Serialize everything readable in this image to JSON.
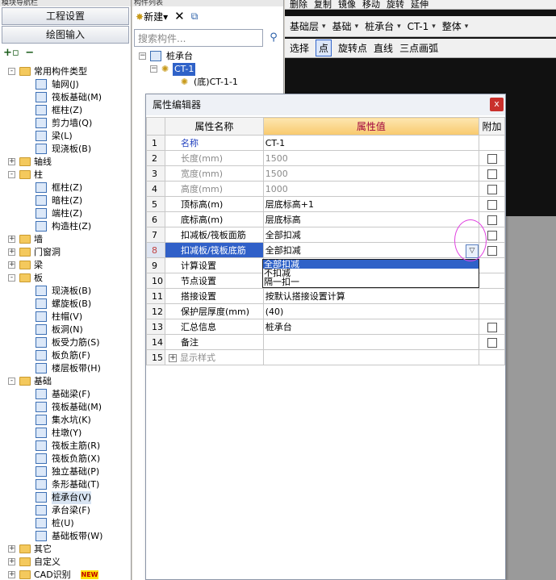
{
  "left_panel": {
    "title": "模块导航栏",
    "btn_settings": "工程设置",
    "btn_drawing": "绘图输入",
    "tree": [
      {
        "label": "常用构件类型",
        "level": 0,
        "kind": "folder",
        "exp": "-"
      },
      {
        "label": "轴网(J)",
        "level": 1,
        "kind": "item"
      },
      {
        "label": "筏板基础(M)",
        "level": 1,
        "kind": "item"
      },
      {
        "label": "框柱(Z)",
        "level": 1,
        "kind": "item"
      },
      {
        "label": "剪力墙(Q)",
        "level": 1,
        "kind": "item"
      },
      {
        "label": "梁(L)",
        "level": 1,
        "kind": "item"
      },
      {
        "label": "现浇板(B)",
        "level": 1,
        "kind": "item"
      },
      {
        "label": "轴线",
        "level": 0,
        "kind": "folder",
        "exp": "+"
      },
      {
        "label": "柱",
        "level": 0,
        "kind": "folder",
        "exp": "-"
      },
      {
        "label": "框柱(Z)",
        "level": 1,
        "kind": "item"
      },
      {
        "label": "暗柱(Z)",
        "level": 1,
        "kind": "item"
      },
      {
        "label": "端柱(Z)",
        "level": 1,
        "kind": "item"
      },
      {
        "label": "构造柱(Z)",
        "level": 1,
        "kind": "item"
      },
      {
        "label": "墙",
        "level": 0,
        "kind": "folder",
        "exp": "+"
      },
      {
        "label": "门窗洞",
        "level": 0,
        "kind": "folder",
        "exp": "+"
      },
      {
        "label": "梁",
        "level": 0,
        "kind": "folder",
        "exp": "+"
      },
      {
        "label": "板",
        "level": 0,
        "kind": "folder",
        "exp": "-"
      },
      {
        "label": "现浇板(B)",
        "level": 1,
        "kind": "item"
      },
      {
        "label": "螺旋板(B)",
        "level": 1,
        "kind": "item"
      },
      {
        "label": "柱帽(V)",
        "level": 1,
        "kind": "item"
      },
      {
        "label": "板洞(N)",
        "level": 1,
        "kind": "item"
      },
      {
        "label": "板受力筋(S)",
        "level": 1,
        "kind": "item"
      },
      {
        "label": "板负筋(F)",
        "level": 1,
        "kind": "item"
      },
      {
        "label": "楼层板带(H)",
        "level": 1,
        "kind": "item"
      },
      {
        "label": "基础",
        "level": 0,
        "kind": "folder",
        "exp": "-"
      },
      {
        "label": "基础梁(F)",
        "level": 1,
        "kind": "item"
      },
      {
        "label": "筏板基础(M)",
        "level": 1,
        "kind": "item"
      },
      {
        "label": "集水坑(K)",
        "level": 1,
        "kind": "item"
      },
      {
        "label": "柱墩(Y)",
        "level": 1,
        "kind": "item"
      },
      {
        "label": "筏板主筋(R)",
        "level": 1,
        "kind": "item"
      },
      {
        "label": "筏板负筋(X)",
        "level": 1,
        "kind": "item"
      },
      {
        "label": "独立基础(P)",
        "level": 1,
        "kind": "item"
      },
      {
        "label": "条形基础(T)",
        "level": 1,
        "kind": "item"
      },
      {
        "label": "桩承台(V)",
        "level": 1,
        "kind": "item",
        "selected": true
      },
      {
        "label": "承台梁(F)",
        "level": 1,
        "kind": "item"
      },
      {
        "label": "桩(U)",
        "level": 1,
        "kind": "item"
      },
      {
        "label": "基础板带(W)",
        "level": 1,
        "kind": "item"
      },
      {
        "label": "其它",
        "level": 0,
        "kind": "folder",
        "exp": "+"
      },
      {
        "label": "自定义",
        "level": 0,
        "kind": "folder",
        "exp": "+"
      },
      {
        "label": "CAD识别",
        "level": 0,
        "kind": "folder",
        "exp": "+",
        "badge": "NEW"
      }
    ]
  },
  "mid_panel": {
    "title": "构件列表",
    "new_label": "新建",
    "search_placeholder": "搜索构件...",
    "tree": {
      "root": "桩承台",
      "child": "CT-1",
      "grandchild": "(底)CT-1-1"
    }
  },
  "toolbar": {
    "row1": [
      "删除",
      "复制",
      "镜像",
      "移动",
      "旋转",
      "延伸"
    ],
    "row2": [
      "基础层",
      "基础",
      "桩承台",
      "CT-1",
      "整体"
    ],
    "row3": [
      "选择",
      "点",
      "旋转点",
      "直线",
      "三点画弧"
    ]
  },
  "dialog": {
    "title": "属性编辑器",
    "col_name": "属性名称",
    "col_value": "属性值",
    "col_add": "附加",
    "rows": [
      {
        "num": "1",
        "name": "名称",
        "value": "CT-1",
        "checkbox": false,
        "style": "blue"
      },
      {
        "num": "2",
        "name": "长度(mm)",
        "value": "1500",
        "checkbox": true,
        "style": "disabled"
      },
      {
        "num": "3",
        "name": "宽度(mm)",
        "value": "1500",
        "checkbox": true,
        "style": "disabled"
      },
      {
        "num": "4",
        "name": "高度(mm)",
        "value": "1000",
        "checkbox": true,
        "style": "disabled"
      },
      {
        "num": "5",
        "name": "顶标高(m)",
        "value": "层底标高+1",
        "checkbox": true,
        "style": ""
      },
      {
        "num": "6",
        "name": "底标高(m)",
        "value": "层底标高",
        "checkbox": true,
        "style": ""
      },
      {
        "num": "7",
        "name": "扣减板/筏板面筋",
        "value": "全部扣减",
        "checkbox": true,
        "style": ""
      },
      {
        "num": "8",
        "name": "扣减板/筏板底筋",
        "value": "全部扣减",
        "checkbox": true,
        "style": "active"
      },
      {
        "num": "9",
        "name": "计算设置",
        "value": "",
        "checkbox": false,
        "style": ""
      },
      {
        "num": "10",
        "name": "节点设置",
        "value": "",
        "checkbox": false,
        "style": ""
      },
      {
        "num": "11",
        "name": "搭接设置",
        "value": "按默认搭接设置计算",
        "checkbox": false,
        "style": ""
      },
      {
        "num": "12",
        "name": "保护层厚度(mm)",
        "value": "(40)",
        "checkbox": false,
        "style": ""
      },
      {
        "num": "13",
        "name": "汇总信息",
        "value": "桩承台",
        "checkbox": true,
        "style": ""
      },
      {
        "num": "14",
        "name": "备注",
        "value": "",
        "checkbox": true,
        "style": ""
      },
      {
        "num": "15",
        "name": "显示样式",
        "value": "",
        "checkbox": false,
        "style": "disabled-plus"
      }
    ],
    "dropdown_options": [
      "全部扣减",
      "不扣减",
      "隔一扣一"
    ],
    "dropdown_selected_index": 0
  }
}
